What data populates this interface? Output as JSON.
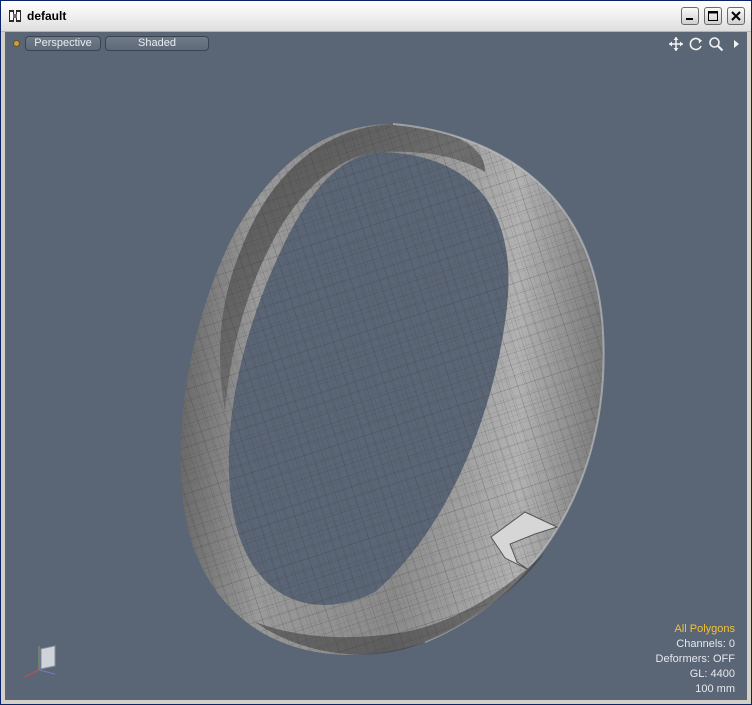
{
  "window": {
    "title": "default",
    "app_icon": "modo-app-icon",
    "controls": [
      "minimize-icon",
      "maximize-icon",
      "close-icon"
    ]
  },
  "viewport": {
    "view_mode": "Perspective",
    "shading_mode": "Shaded",
    "tools": [
      "move-icon",
      "rotate-icon",
      "zoom-icon",
      "menu-arrow-icon"
    ],
    "background_color": "#5a6575",
    "info": {
      "selection": "All Polygons",
      "channels": "Channels: 0",
      "deformers": "Deformers: OFF",
      "gl": "GL: 4400",
      "grid_unit": "100 mm"
    },
    "highlight_color": "#f0c23a"
  }
}
